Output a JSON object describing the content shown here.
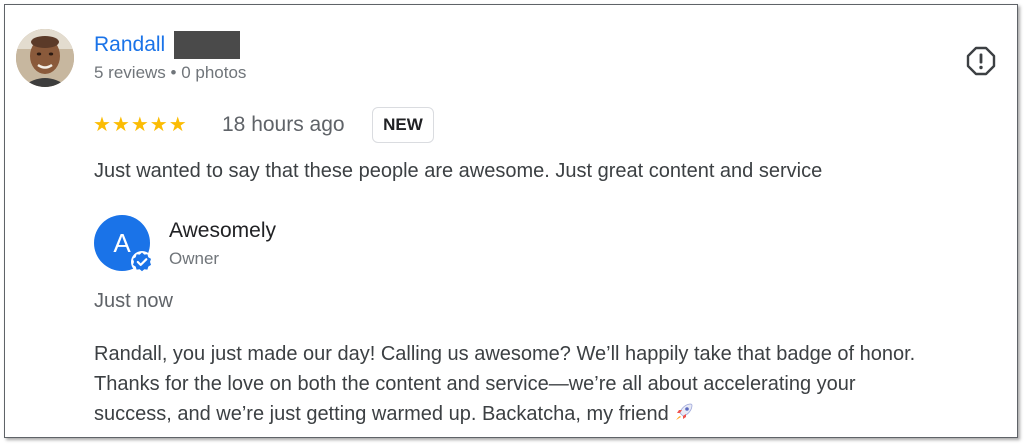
{
  "reviewer": {
    "name": "Randall",
    "meta": "5 reviews • 0 photos",
    "avatar_icon": "person-photo-avatar"
  },
  "review": {
    "stars": "★★★★★",
    "rating": 5,
    "time_ago": "18 hours ago",
    "badge": "NEW",
    "text": "Just wanted to say that these people are awesome. Just great content and service"
  },
  "owner_reply": {
    "avatar_letter": "A",
    "name": "Awesomely",
    "role": "Owner",
    "time": "Just now",
    "lines": [
      "Randall, you just made our day! Calling us awesome? We’ll happily take that badge of honor.",
      "Thanks for the love on both the content and service—we’re all about accelerating your",
      "success, and we’re just getting warmed up. Backatcha, my friend"
    ],
    "emoji": "rocket-icon"
  },
  "colors": {
    "name_link": "#1a73e8",
    "star": "#fbbc04",
    "owner_avatar": "#1a73e8"
  }
}
